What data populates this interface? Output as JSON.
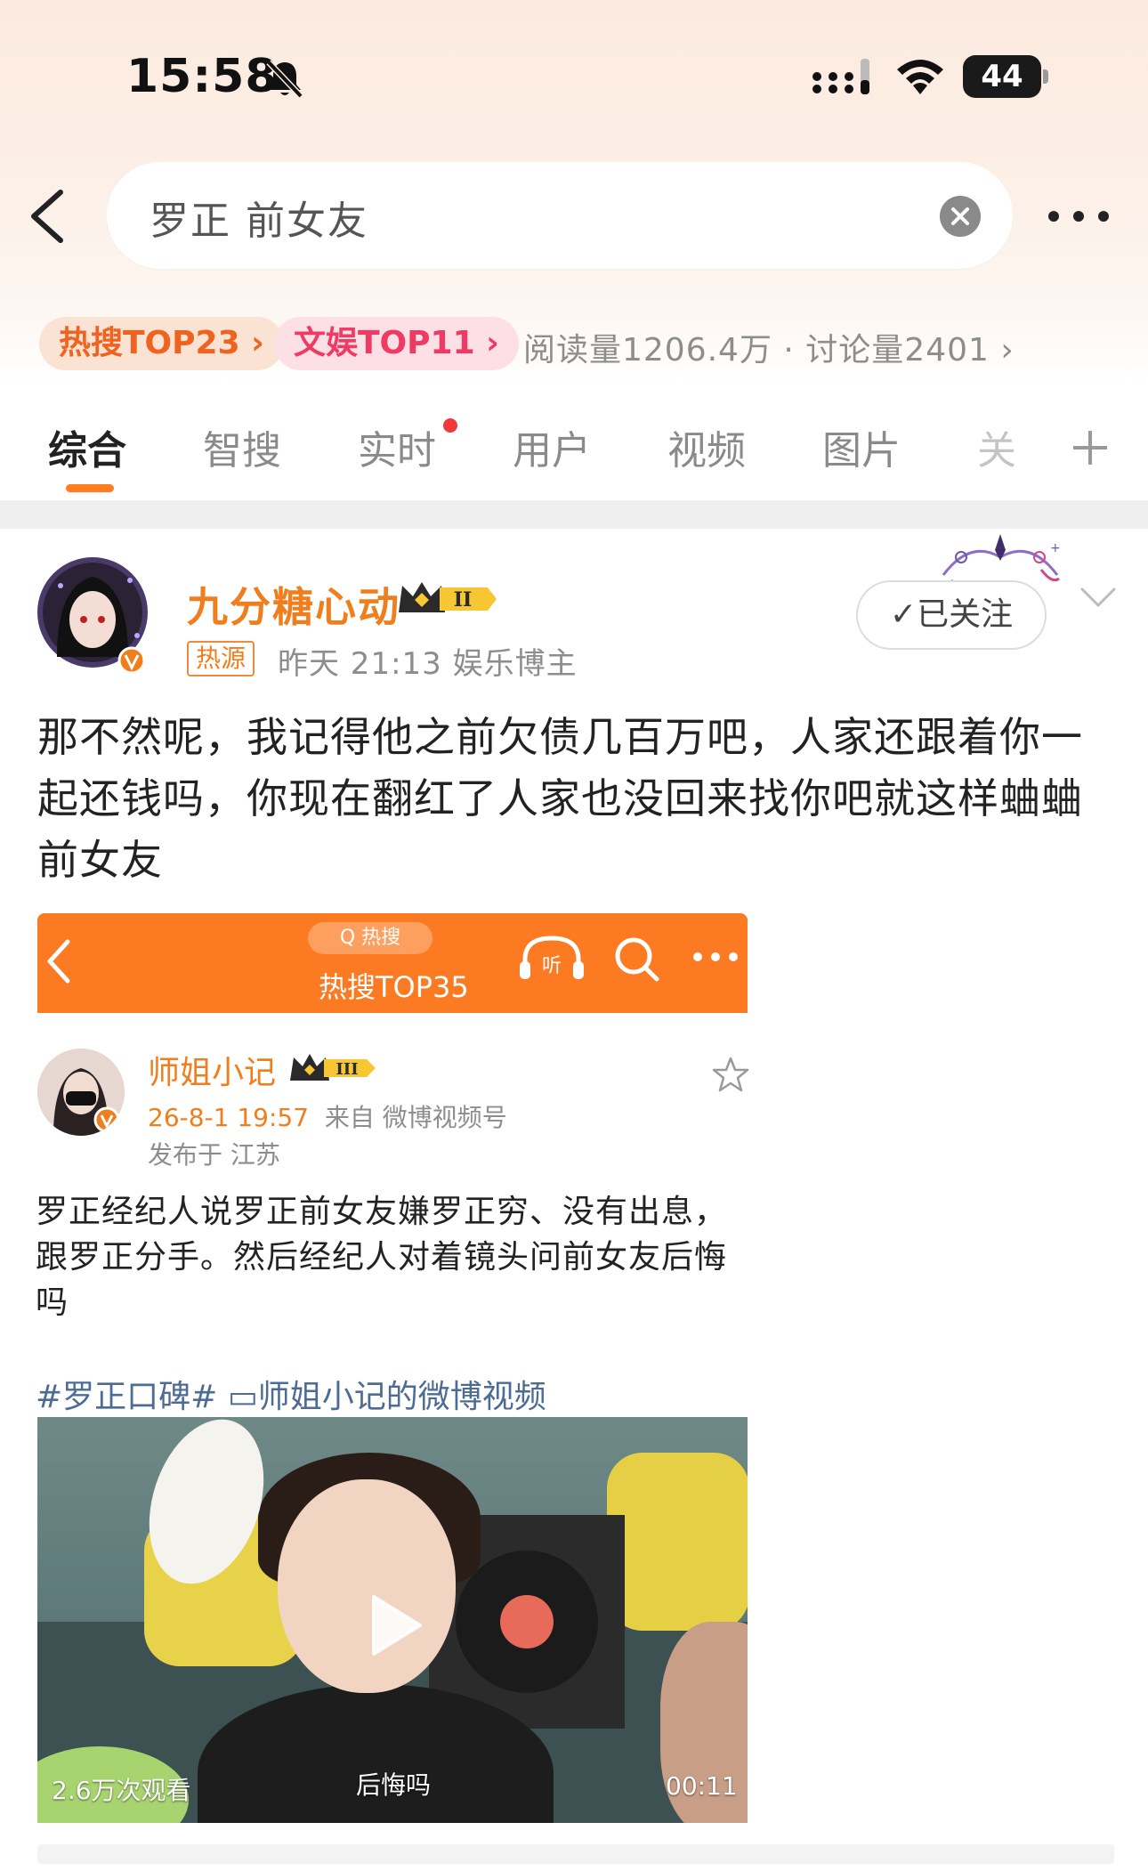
{
  "status_bar": {
    "time": "15:58",
    "battery_level": "44"
  },
  "search": {
    "query": "罗正 前女友"
  },
  "hot_stats": {
    "hot_search": "热搜TOP23 ›",
    "ent_rank": "文娱TOP11 ›",
    "read_discuss": "阅读量1206.4万 · 讨论量2401 ›"
  },
  "tabs": [
    {
      "label": "综合",
      "active": true
    },
    {
      "label": "智搜",
      "active": false
    },
    {
      "label": "实时",
      "active": false
    },
    {
      "label": "用户",
      "active": false
    },
    {
      "label": "视频",
      "active": false
    },
    {
      "label": "图片",
      "active": false
    },
    {
      "label": "关",
      "active": false
    }
  ],
  "post": {
    "username": "九分糖心动",
    "source_tag": "热源",
    "meta": "昨天 21:13  娱乐博主",
    "follow_label": "✓已关注",
    "text": "那不然呢，我记得他之前欠债几百万吧，人家还跟着你一起还钱吗，你现在翻红了人家也没回来找你吧就这样蛐蛐前女友",
    "crown_level": "II"
  },
  "embed": {
    "pill": "Q 热搜",
    "title": "热搜TOP35",
    "listen_label": "听",
    "username": "师姐小记",
    "crown_level": "III",
    "date": "26-8-1 19:57",
    "from_label": "来自 微博视频号",
    "location": "发布于 江苏",
    "text": "罗正经纪人说罗正前女友嫌罗正穷、没有出息，跟罗正分手。然后经纪人对着镜头问前女友后悔吗",
    "tags": "#罗正口碑# ▭师姐小记的微博视频",
    "video": {
      "views": "2.6万次观看",
      "caption": "后悔吗",
      "duration": "00:11"
    }
  },
  "colors": {
    "accent_orange": "#f07e1d",
    "tab_underline": "#ff7c1f",
    "link_blue": "#4d6c94",
    "embed_bar": "#fb7a22"
  }
}
